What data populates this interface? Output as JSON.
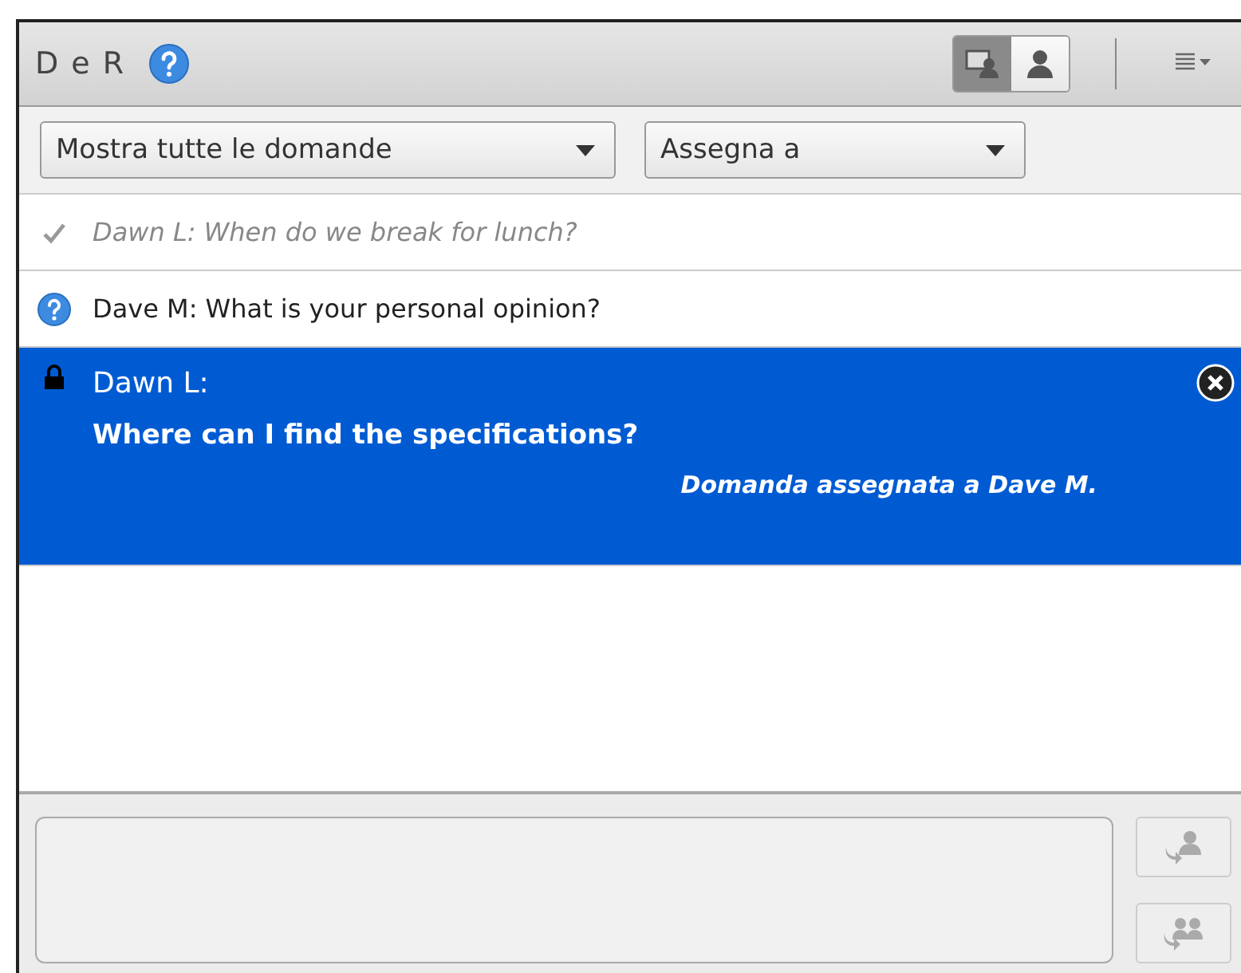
{
  "panel": {
    "title": "D e R"
  },
  "view_toggles": [
    {
      "kind": "presenter",
      "selected": true
    },
    {
      "kind": "participant",
      "selected": false
    }
  ],
  "filters": {
    "show": "Mostra tutte le domande",
    "assign": "Assegna a"
  },
  "questions": [
    {
      "kind": "answered",
      "selected": false,
      "author": "Dawn L:",
      "text": "When do we break for lunch?"
    },
    {
      "kind": "open",
      "selected": false,
      "author": "Dave M:",
      "text": "What is your personal opinion?"
    },
    {
      "kind": "locked",
      "selected": true,
      "author": "Dawn L:",
      "text": "Where can I find the specifications?",
      "note": "Domanda assegnata a Dave M."
    }
  ],
  "reply": {
    "disabled": true
  }
}
